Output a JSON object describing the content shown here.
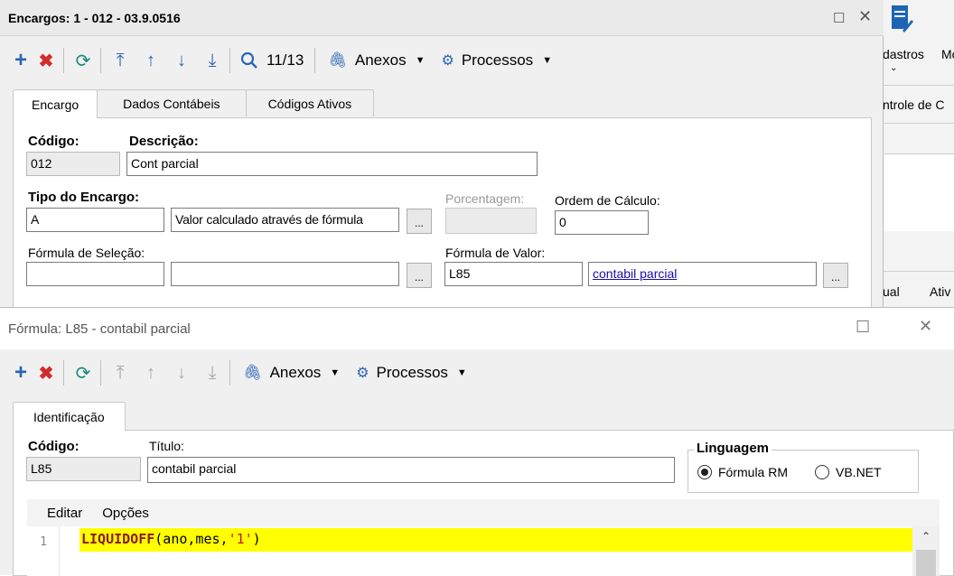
{
  "background_app": {
    "labels": [
      "dastros",
      "Mo",
      "ntrole de C",
      "ual",
      "Ativ"
    ]
  },
  "window1": {
    "title": "Encargos: 1 - 012 - 03.9.0516",
    "controls": {
      "maximize": "☐",
      "close": "✕"
    },
    "toolbar": {
      "counter": "11/13",
      "anexos": "Anexos",
      "processos": "Processos"
    },
    "tabs": [
      "Encargo",
      "Dados Contábeis",
      "Códigos Ativos"
    ],
    "form": {
      "codigo_label": "Código:",
      "codigo_value": "012",
      "descricao_label": "Descrição:",
      "descricao_value": "Cont parcial",
      "tipo_label": "Tipo do Encargo:",
      "tipo_code": "A",
      "tipo_desc": "Valor calculado através de fórmula",
      "porcentagem_label": "Porcentagem:",
      "porcentagem_value": "",
      "ordem_label": "Ordem de Cálculo:",
      "ordem_value": "0",
      "formula_selecao_label": "Fórmula de Seleção:",
      "formula_selecao_code": "",
      "formula_selecao_desc": "",
      "formula_valor_label": "Fórmula de Valor:",
      "formula_valor_code": "L85",
      "formula_valor_link": "contabil parcial",
      "ellipsis": "..."
    }
  },
  "window2": {
    "title": "Fórmula: L85 - contabil parcial",
    "controls": {
      "maximize": "☐",
      "close": "✕"
    },
    "toolbar": {
      "anexos": "Anexos",
      "processos": "Processos"
    },
    "tabs": [
      "Identificação"
    ],
    "form": {
      "codigo_label": "Código:",
      "codigo_value": "L85",
      "titulo_label": "Título:",
      "titulo_value": "contabil parcial",
      "linguagem_label": "Linguagem",
      "option_rm": "Fórmula RM",
      "option_vb": "VB.NET",
      "selected": "Fórmula RM"
    },
    "editor": {
      "menu": [
        "Editar",
        "Opções"
      ],
      "line_number": "1",
      "code_func": "LIQUIDOFF",
      "code_args_a": "(ano,mes,",
      "code_string": "'1'",
      "code_args_b": ")"
    }
  }
}
